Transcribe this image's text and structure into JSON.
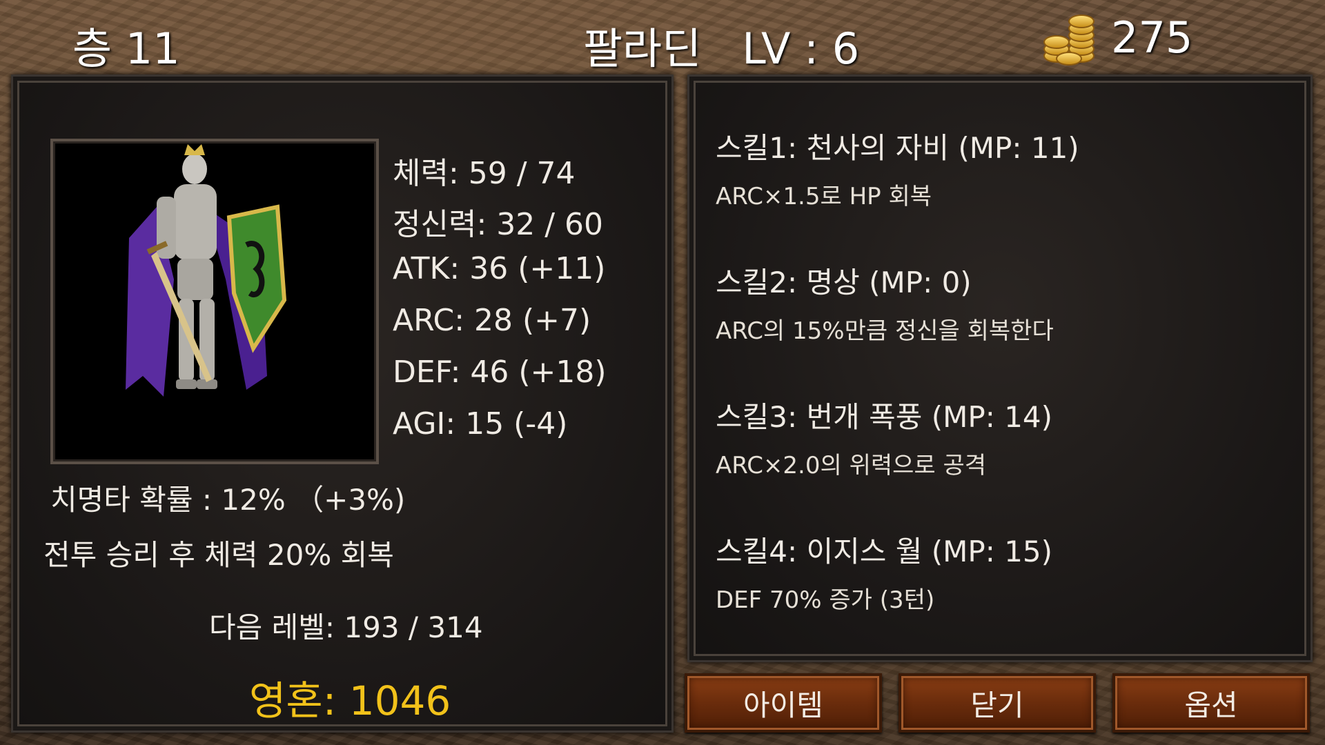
{
  "header": {
    "floor": "층 11",
    "title": "팔라딘   LV : 6",
    "gold": "275",
    "gold_icon": "gold-coins-icon"
  },
  "stats": {
    "hp": "체력: 59 / 74",
    "mp": "정신력: 32 / 60",
    "atk": "ATK: 36 (+11)",
    "arc": "ARC: 28 (+7)",
    "def": "DEF: 46 (+18)",
    "agi": "AGI: 15 (-4)",
    "crit": "치명타 확률 : 12% （+3%)",
    "passive": "전투 승리 후 체력 20% 회복",
    "next_level": "다음 레벨: 193 / 314",
    "soul": "영혼: 1046"
  },
  "skills": [
    {
      "title": "스킬1: 천사의 자비 (MP: 11)",
      "desc": "ARC×1.5로 HP 회복"
    },
    {
      "title": "스킬2: 명상 (MP: 0)",
      "desc": "ARC의 15%만큼 정신을 회복한다"
    },
    {
      "title": "스킬3: 번개 폭풍 (MP: 14)",
      "desc": "ARC×2.0의 위력으로 공격"
    },
    {
      "title": "스킬4: 이지스 월 (MP: 15)",
      "desc": "DEF 70% 증가 (3턴)"
    }
  ],
  "buttons": {
    "items": "아이템",
    "close": "닫기",
    "options": "옵션"
  },
  "colors": {
    "soul": "#f2c21a",
    "button": "#6a2c0c"
  }
}
